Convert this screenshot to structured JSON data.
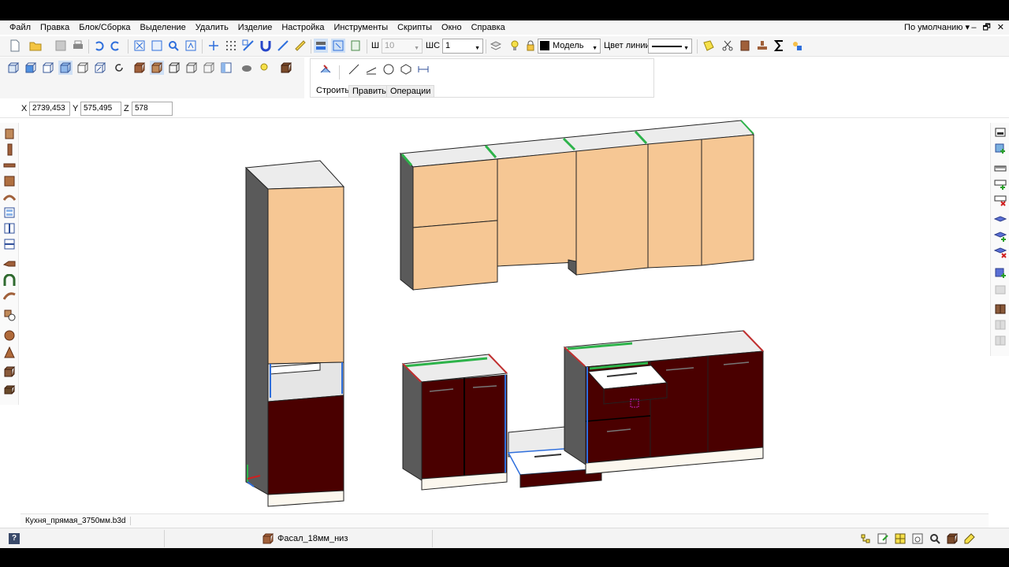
{
  "menu": [
    "Файл",
    "Правка",
    "Блок/Сборка",
    "Выделение",
    "Удалить",
    "Изделие",
    "Настройка",
    "Инструменты",
    "Скрипты",
    "Окно",
    "Справка"
  ],
  "profile": "По умолчанию ▾",
  "window_controls": [
    "–",
    "🗗",
    "✕"
  ],
  "toolbar": {
    "sh_label": "Ш",
    "sh_value": "10",
    "shs_label": "ШС",
    "shs_value": "1",
    "layer_value": "Модель",
    "line_color_label": "Цвет линии"
  },
  "build_tabs": [
    "Строить",
    "Править",
    "Операции"
  ],
  "coords": {
    "x_label": "X",
    "x": "2739,453",
    "y_label": "Y",
    "y": "575,495",
    "z_label": "Z",
    "z": "578"
  },
  "file_tab": "Кухня_прямая_3750мм.b3d",
  "status": {
    "help": "?",
    "layer": "Фасал_18мм_низ"
  },
  "colors": {
    "facade_light": "#f6c794",
    "facade_dark": "#4a0000",
    "carcass": "#5a5a5a",
    "edge_green": "#2db34a",
    "edge_blue": "#2f6fdc"
  }
}
